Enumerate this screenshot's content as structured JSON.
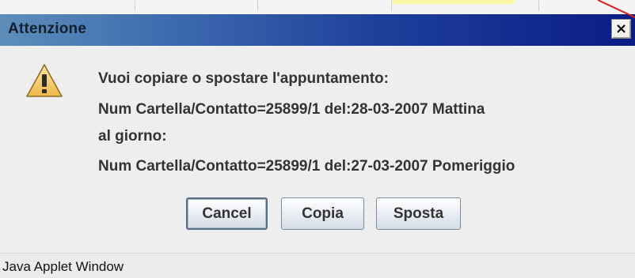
{
  "dialog": {
    "title": "Attenzione",
    "close_symbol": "×",
    "icon": "warning-icon",
    "message_lines": [
      "Vuoi copiare o spostare l'appuntamento:",
      "Num Cartella/Contatto=25899/1 del:28-03-2007 Mattina",
      "al giorno:",
      "Num Cartella/Contatto=25899/1 del:27-03-2007 Pomeriggio"
    ],
    "buttons": {
      "cancel": "Cancel",
      "copy": "Copia",
      "move": "Sposta"
    }
  },
  "footer": {
    "text": "Java Applet Window"
  },
  "colors": {
    "title_bar_start": "#5d8eba",
    "title_bar_end": "#0a1c86",
    "background": "#eeeeee",
    "text": "#333333",
    "warning_fill": "#f6d27a",
    "annotation_red": "#d62020"
  }
}
